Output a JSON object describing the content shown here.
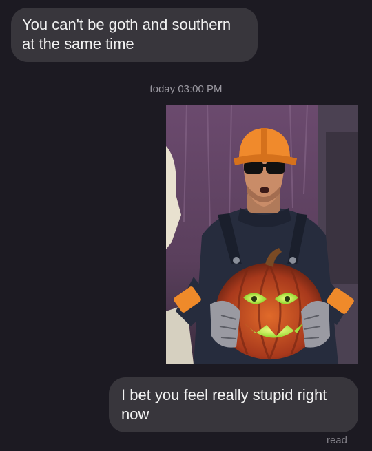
{
  "conversation": {
    "messages": [
      {
        "direction": "incoming",
        "text": "You can't be goth and southern at the same time"
      },
      {
        "direction": "meta",
        "text": "today 03:00 PM"
      },
      {
        "direction": "outgoing",
        "type": "image",
        "description": "illustration: man in orange hard hat and sunglasses holding a glowing jack-o'-lantern"
      },
      {
        "direction": "outgoing",
        "text": "I bet you feel really stupid right now"
      }
    ],
    "read_status": "read"
  },
  "colors": {
    "background": "#1c1a22",
    "bubble": "#38363c",
    "text": "#f2f2f2",
    "meta_text": "#9a98a0",
    "hat": "#f08a2c",
    "pumpkin_glow": "#c6ff3a"
  }
}
